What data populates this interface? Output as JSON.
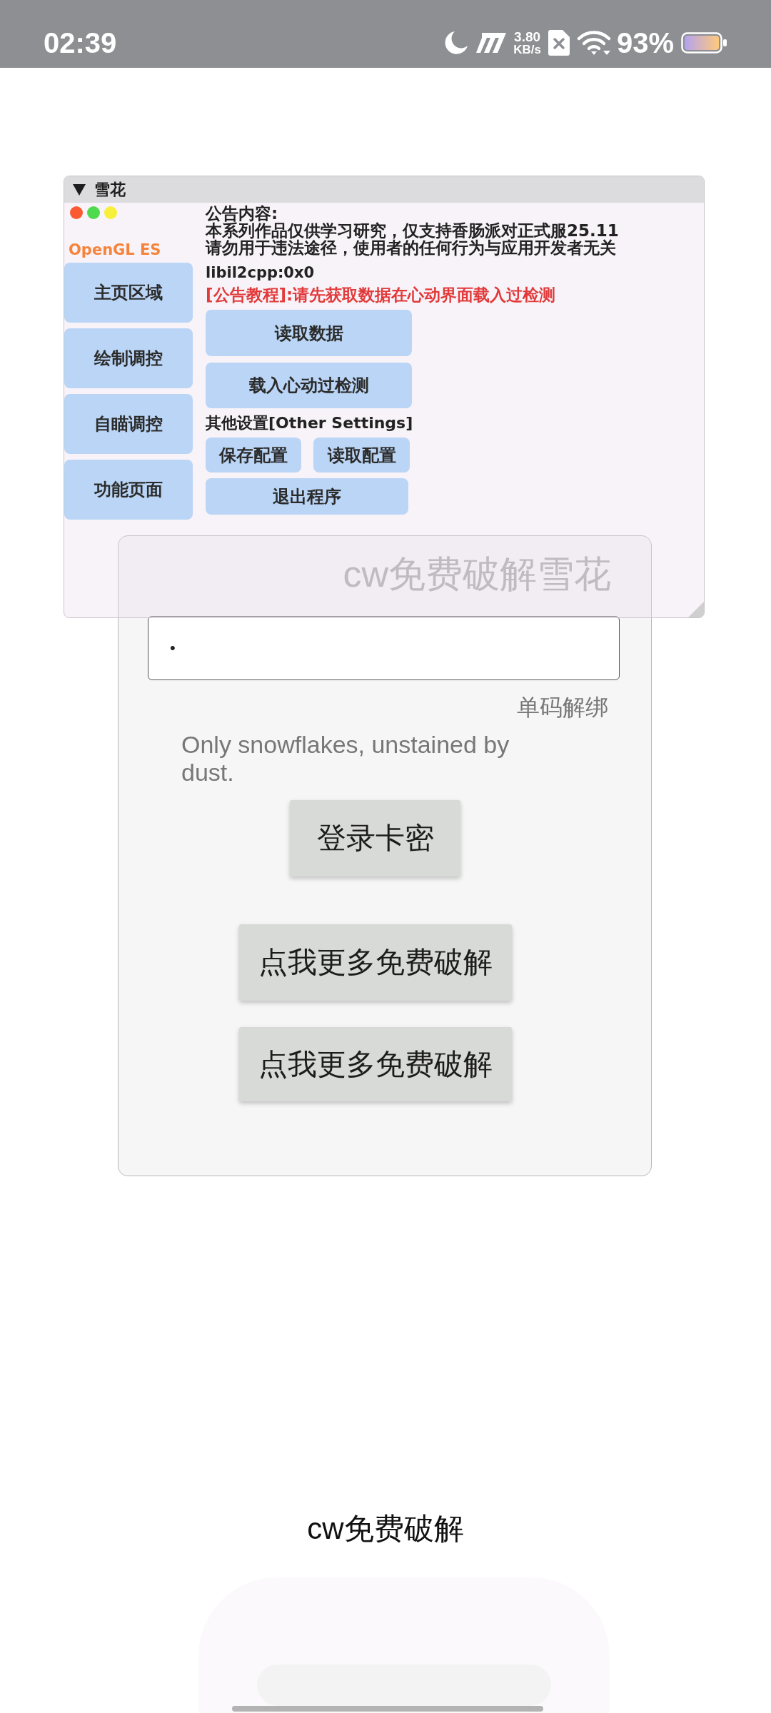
{
  "status_bar": {
    "time": "02:39",
    "speed_value": "3.80",
    "speed_unit": "KB/s",
    "battery_text": "93%"
  },
  "overlay_window": {
    "title": "雪花",
    "expanded": true,
    "window_dots": [
      {
        "color": "#fa5a32"
      },
      {
        "color": "#4ddb4d"
      },
      {
        "color": "#f7ef3a"
      }
    ],
    "renderer": "OpenGL ES",
    "sidebar": {
      "items": [
        "主页区域",
        "绘制调控",
        "自瞄调控",
        "功能页面"
      ]
    },
    "content": {
      "notice_title": "公告内容:",
      "notice_lines": [
        "本系列作品仅供学习研究，仅支持香肠派对正式服25.11",
        "请勿用于违法途径，使用者的任何行为与应用开发者无关"
      ],
      "address": "libil2cpp:0x0",
      "tutorial": "[公告教程]:请先获取数据在心动界面载入过检测",
      "actions": [
        "读取数据",
        "载入心动过检测"
      ],
      "settings_title": "其他设置[Other Settings]",
      "settings_buttons": [
        "保存配置",
        "读取配置"
      ],
      "exit_button": "退出程序"
    }
  },
  "login_card": {
    "title": "cw免费破解雪花",
    "password": {
      "value": "•"
    },
    "unbind_link": "单码解绑",
    "motto": "Only snowflakes, unstained by dust.",
    "login_button": "登录卡密",
    "more_buttons": [
      "点我更多免费破解",
      "点我更多免费破解"
    ]
  },
  "footer": {
    "caption": "cw免费破解"
  }
}
